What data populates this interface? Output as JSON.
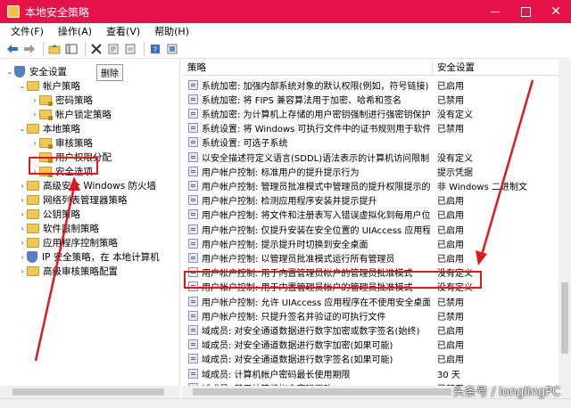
{
  "window": {
    "title": "本地安全策略",
    "brand_color": "#e5134a"
  },
  "menu": [
    "文件(F)",
    "操作(A)",
    "查看(V)",
    "帮助(H)"
  ],
  "toolbar": {
    "icons": [
      "back-arrow-icon",
      "forward-arrow-icon",
      "up-folder-icon",
      "show-tree-icon",
      "delete-icon",
      "properties-icon",
      "export-icon",
      "help-icon",
      "help-book-icon"
    ],
    "delete_tooltip": "删除"
  },
  "tree": {
    "items": [
      {
        "label": "安全设置",
        "level": 0,
        "expanded": true,
        "icon": "shield-icon"
      },
      {
        "label": "帐户策略",
        "level": 1,
        "expanded": true,
        "icon": "folder-icon"
      },
      {
        "label": "密码策略",
        "level": 2,
        "expanded": false,
        "icon": "folder-icon"
      },
      {
        "label": "帐户锁定策略",
        "level": 2,
        "expanded": false,
        "icon": "folder-icon"
      },
      {
        "label": "本地策略",
        "level": 1,
        "expanded": true,
        "icon": "folder-icon"
      },
      {
        "label": "审核策略",
        "level": 2,
        "expanded": false,
        "icon": "folder-icon"
      },
      {
        "label": "用户权限分配",
        "level": 2,
        "expanded": false,
        "icon": "folder-icon"
      },
      {
        "label": "安全选项",
        "level": 2,
        "expanded": false,
        "icon": "folder-open-icon",
        "selected": true
      },
      {
        "label": "高级安全 Windows 防火墙",
        "level": 1,
        "expanded": false,
        "icon": "folder-icon"
      },
      {
        "label": "网络列表管理器策略",
        "level": 1,
        "expanded": false,
        "icon": "folder-icon"
      },
      {
        "label": "公钥策略",
        "level": 1,
        "expanded": false,
        "icon": "folder-icon"
      },
      {
        "label": "软件限制策略",
        "level": 1,
        "expanded": false,
        "icon": "folder-icon"
      },
      {
        "label": "应用程序控制策略",
        "level": 1,
        "expanded": false,
        "icon": "folder-icon"
      },
      {
        "label": "IP 安全策略，在 本地计算机",
        "level": 1,
        "expanded": false,
        "icon": "ip-security-icon"
      },
      {
        "label": "高级审核策略配置",
        "level": 1,
        "expanded": false,
        "icon": "folder-icon"
      }
    ]
  },
  "list": {
    "columns": [
      "策略",
      "安全设置"
    ],
    "highlighted_index": 14,
    "rows": [
      {
        "name": "系统加密: 加强内部系统对象的默认权限(例如，符号链接)",
        "value": "已启用"
      },
      {
        "name": "系统加密: 将 FIPS 兼容算法用于加密、哈希和签名",
        "value": "已禁用"
      },
      {
        "name": "系统加密: 为计算机上存储的用户密钥强制进行强密钥保护",
        "value": "没有定义"
      },
      {
        "name": "系统设置: 将 Windows 可执行文件中的证书规则用于软件...",
        "value": "已禁用"
      },
      {
        "name": "系统设置: 可选子系统",
        "value": ""
      },
      {
        "name": "以安全描述符定义语言(SDDL)语法表示的计算机访问限制",
        "value": "没有定义"
      },
      {
        "name": "用户帐户控制: 标准用户的提升提示行为",
        "value": "提示凭据"
      },
      {
        "name": "用户帐户控制: 管理员批准模式中管理员的提升权限提示的...",
        "value": "非 Windows 二进制文"
      },
      {
        "name": "用户帐户控制: 检测应用程序安装并提示提升",
        "value": "已启用"
      },
      {
        "name": "用户帐户控制: 将文件和注册表写入错误虚拟化到每用户位置",
        "value": "已启用"
      },
      {
        "name": "用户帐户控制: 仅提升安装在安全位置的 UIAccess 应用程序",
        "value": "已启用"
      },
      {
        "name": "用户帐户控制: 提示提升时切换到安全桌面",
        "value": "已启用"
      },
      {
        "name": "用户帐户控制: 以管理员批准模式运行所有管理员",
        "value": "已启用"
      },
      {
        "name": "用户帐户控制: 用于内置管理员帐户的管理员批准模式",
        "value": "没有定义"
      },
      {
        "name": "用户帐户控制: 用于内置管理员帐户的管理员批准模式",
        "value": "没有定义"
      },
      {
        "name": "用户帐户控制: 允许 UIAccess 应用程序在不使用安全桌面...",
        "value": "已禁用"
      },
      {
        "name": "用户帐户控制: 只提升签名并验证的可执行文件",
        "value": "已禁用"
      },
      {
        "name": "域成员: 对安全通道数据进行数字加密或数字签名(始终)",
        "value": "已启用"
      },
      {
        "name": "域成员: 对安全通道数据进行数字加密(如果可能)",
        "value": "已启用"
      },
      {
        "name": "域成员: 对安全通道数据进行数字签名(如果可能)",
        "value": "已启用"
      },
      {
        "name": "域成员: 计算机帐户密码最长使用期限",
        "value": "30 天"
      },
      {
        "name": "域成员: 禁用计算机帐户密码更改",
        "value": "已禁用"
      }
    ]
  },
  "annotation_color": "#e0191f",
  "watermark": "头条号 / longlingPC"
}
